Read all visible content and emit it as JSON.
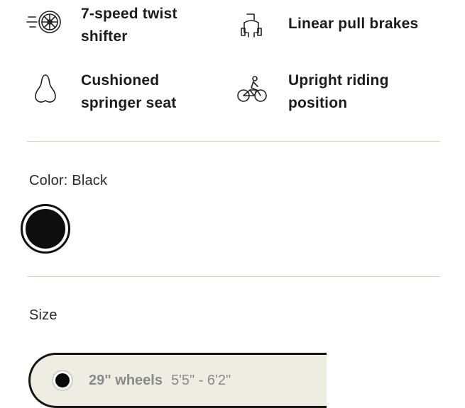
{
  "features": [
    {
      "icon": "twist-shifter-icon",
      "label": "7-speed twist shifter"
    },
    {
      "icon": "brakes-icon",
      "label": "Linear pull brakes"
    },
    {
      "icon": "saddle-icon",
      "label": "Cushioned springer seat"
    },
    {
      "icon": "cyclist-icon",
      "label": "Upright riding position"
    }
  ],
  "color": {
    "label": "Color: Black",
    "selected_value": "#0e0e0e",
    "swatch_border": "#111111"
  },
  "size": {
    "label": "Size",
    "option": {
      "wheels": "29\" wheels",
      "range": "5'5\" - 6'2\""
    }
  },
  "colors": {
    "divider": "#d9d4bc",
    "option_background": "#efece1",
    "muted_text": "#8a8a88"
  }
}
